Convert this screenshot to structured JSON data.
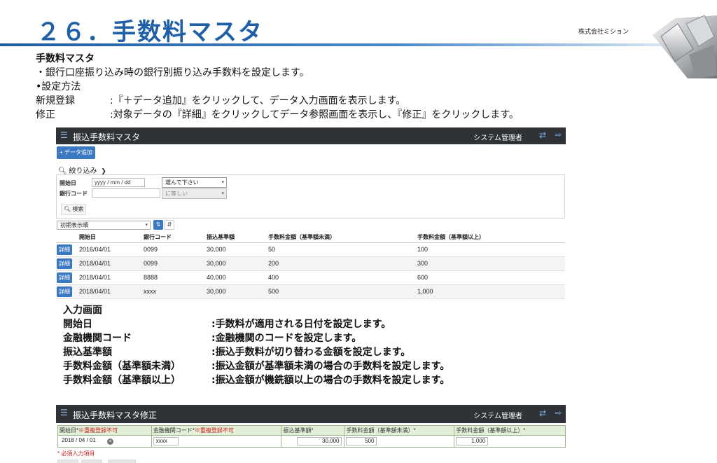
{
  "slide": {
    "title": "２６．手数料マスタ",
    "company": "株式会社ミション"
  },
  "description": {
    "heading": "手数料マスタ",
    "summary": "・銀行口座振り込み時の銀行別振り込み手数料を設定します。",
    "method": "•設定方法",
    "rows": [
      {
        "label": "新規登録",
        "text": ":『＋データ追加』をクリックして、データ入力画面を表示します。"
      },
      {
        "label": "修正",
        "text": ":対象データの『詳細』をクリックしてデータ参照画面を表示し、『修正』をクリックします。"
      }
    ]
  },
  "list_screen": {
    "header": {
      "title": "振込手数料マスタ",
      "user": "システム管理者",
      "menu_icon": "list-icon",
      "swap_icon": "swap-icon",
      "logout_icon": "logout-icon"
    },
    "add_button": "+ データ追加",
    "filter_toggle": "絞り込み",
    "filter": {
      "start_date_label": "開始日",
      "start_date_placeholder": "yyyy / mm / dd",
      "date_condition": "選んで下さい",
      "bank_code_label": "銀行コード",
      "bank_condition": "に等しい",
      "search_button": "検索"
    },
    "sort_select": "初期表示順",
    "sort_asc_icon": "sort-ascending-icon",
    "sort_desc_icon": "sort-descending-icon",
    "columns": [
      "開始日",
      "銀行コード",
      "振込基準額",
      "手数料金額（基準額未満）",
      "手数料金額（基準額以上）"
    ],
    "detail_label": "詳細",
    "rows": [
      [
        "2016/04/01",
        "0099",
        "30,000",
        "50",
        "100"
      ],
      [
        "2018/04/01",
        "0099",
        "30,000",
        "200",
        "300"
      ],
      [
        "2018/04/01",
        "8888",
        "40,000",
        "400",
        "600"
      ],
      [
        "2018/04/01",
        "xxxx",
        "30,000",
        "500",
        "1,000"
      ]
    ]
  },
  "input_explanation": {
    "heading": "入力画面",
    "items": [
      {
        "label": "開始日",
        "text": ":手数料が適用される日付を設定します。"
      },
      {
        "label": "金融機関コード",
        "text": ":金融機関のコードを設定します。"
      },
      {
        "label": "振込基準額",
        "text": ":振込手数料が切り替わる金額を設定します。"
      },
      {
        "label": "手数料金額（基準額未満）",
        "text": ":振込金額が基準額未満の場合の手数料を設定します。"
      },
      {
        "label": "手数料金額（基準額以上）",
        "text": ":振込金額が機銑額以上の場合の手数料を設定します。"
      }
    ]
  },
  "edit_screen": {
    "header": {
      "title": "振込手数料マスタ修正",
      "user": "システム管理者"
    },
    "columns": [
      {
        "label": "開始日*",
        "note": "※重複登録不可"
      },
      {
        "label": "金融機関コード*",
        "note": "※重複登録不可"
      },
      {
        "label": "振込基準額*",
        "note": ""
      },
      {
        "label": "手数料金額（基準額未満）*",
        "note": ""
      },
      {
        "label": "手数料金額（基準額以上）*",
        "note": ""
      }
    ],
    "values": {
      "start_date": "2018 / 04 / 01",
      "bank_code": "xxxx",
      "base_amount": "30,000",
      "fee_below": "500",
      "fee_above": "1,000"
    },
    "required_note": "* 必須入力項目"
  }
}
